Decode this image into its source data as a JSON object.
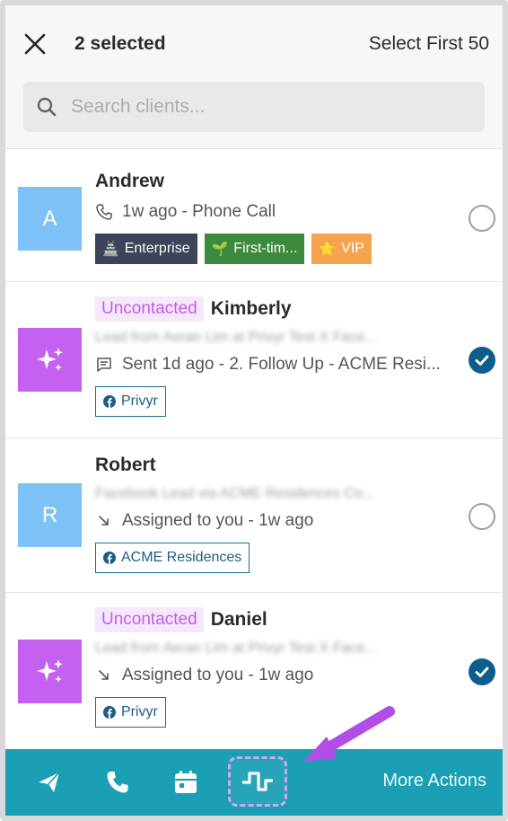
{
  "header": {
    "close_icon": "close-icon",
    "selected_count": "2 selected",
    "select_first": "Select First 50"
  },
  "search": {
    "placeholder": "Search clients...",
    "icon": "search-icon"
  },
  "clients": [
    {
      "name": "Andrew",
      "avatar_letter": "A",
      "avatar_color": "#7ec1f7",
      "activity": "1w ago - Phone Call",
      "activity_icon": "phone-icon",
      "tags": [
        {
          "label": "Enterprise",
          "emoji": "🏯",
          "color": "#3d4358"
        },
        {
          "label": "First-tim...",
          "emoji": "🌱",
          "color": "#3b8a3e"
        },
        {
          "label": "VIP",
          "emoji": "⭐",
          "color": "#f5a34e"
        }
      ],
      "selected": false
    },
    {
      "name": "Kimberly",
      "status": "Uncontacted",
      "avatar_color": "#c561f0",
      "avatar_icon": "sparkle-icon",
      "blurred_text": "Lead from Aeran Lim at Privyr Test X Face...",
      "activity": "Sent 1d ago - 2. Follow Up - ACME Resi...",
      "activity_icon": "message-icon",
      "source": "Privyr",
      "selected": true
    },
    {
      "name": "Robert",
      "avatar_letter": "R",
      "avatar_color": "#7ec1f7",
      "blurred_text": "Facebook Lead via ACME Residences  Co...",
      "activity": "Assigned to you - 1w ago",
      "activity_icon": "assigned-arrow-icon",
      "source": "ACME Residences",
      "selected": false
    },
    {
      "name": "Daniel",
      "status": "Uncontacted",
      "avatar_color": "#c561f0",
      "avatar_icon": "sparkle-icon",
      "blurred_text": "Lead from Aeran Lim at Privyr Test X Face...",
      "activity": "Assigned to you - 1w ago",
      "activity_icon": "assigned-arrow-icon",
      "source": "Privyr",
      "selected": true
    }
  ],
  "toolbar": {
    "icons": [
      "send-icon",
      "phone-icon",
      "calendar-icon",
      "activity-icon"
    ],
    "more_actions": "More Actions",
    "color": "#1a9fb4"
  }
}
